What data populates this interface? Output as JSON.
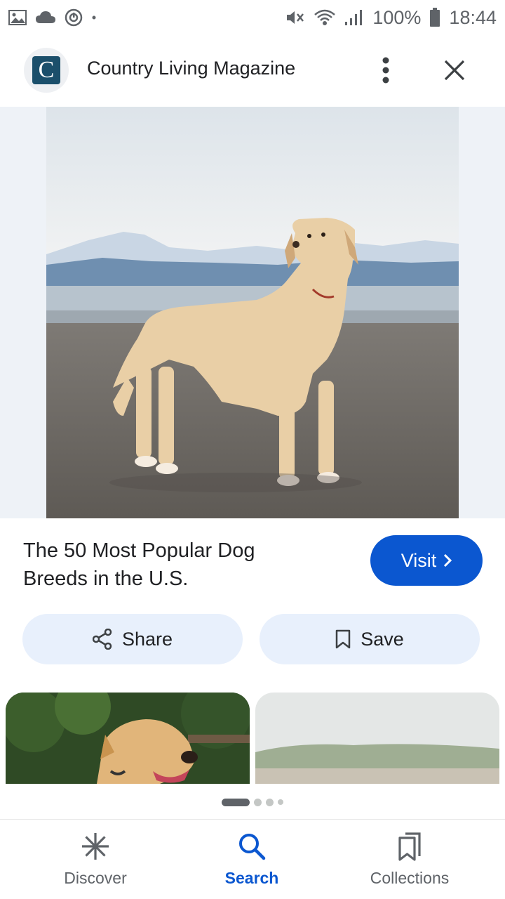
{
  "status_bar": {
    "battery": "100%",
    "time": "18:44",
    "icons": [
      "gallery-icon",
      "cloud-icon",
      "sync-icon",
      "mute-icon",
      "wifi-icon",
      "signal-icon",
      "battery-icon"
    ]
  },
  "header": {
    "site_name": "Country Living Magazine",
    "logo_letter": "C",
    "more_icon": "more-vert-icon",
    "close_icon": "close-icon"
  },
  "result": {
    "title": "The 50 Most Popular Dog Breeds in the U.S.",
    "visit_label": "Visit",
    "share_label": "Share",
    "save_label": "Save"
  },
  "bottom_nav": {
    "items": [
      {
        "label": "Discover",
        "icon": "asterisk-icon"
      },
      {
        "label": "Search",
        "icon": "search-icon",
        "active": true
      },
      {
        "label": "Collections",
        "icon": "collections-icon"
      }
    ]
  },
  "colors": {
    "accent": "#0b57d0",
    "pill_bg": "#e8f0fc"
  }
}
